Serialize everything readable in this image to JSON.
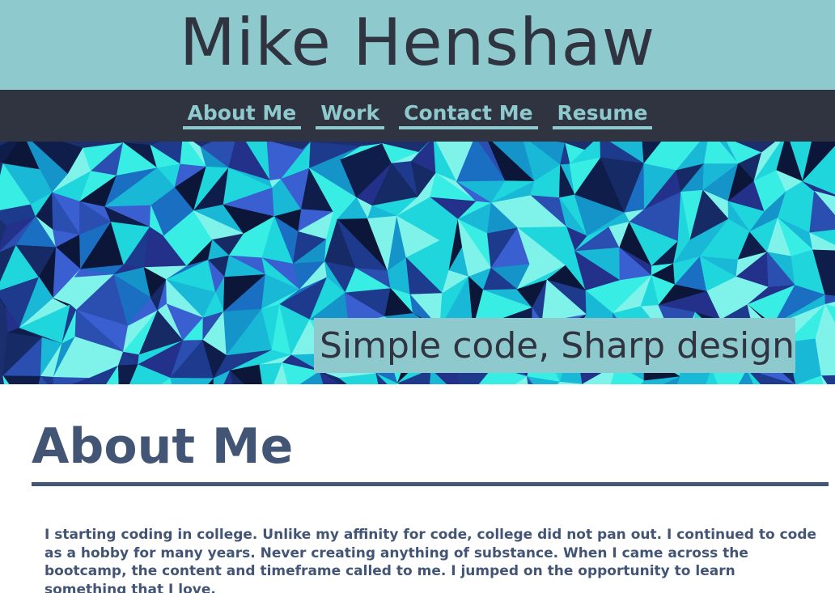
{
  "site": {
    "title": "Mike Henshaw"
  },
  "nav": {
    "items": [
      {
        "label": "About Me"
      },
      {
        "label": "Work"
      },
      {
        "label": "Contact Me"
      },
      {
        "label": "Resume"
      }
    ]
  },
  "hero": {
    "tagline": "Simple code, Sharp design"
  },
  "about": {
    "heading": "About Me",
    "body": "I starting coding in college. Unlike my affinity for code, college did not pan out. I continued to code as a hobby for many years. Never creating anything of substance. When I came across the bootcamp, the content and timeframe called to me. I jumped on the opportunity to learn something that I love."
  },
  "colors": {
    "header_bg": "#8ec9cd",
    "nav_bg": "#2f3440",
    "accent_text": "#435575",
    "hero_dark": "#1b2f6e",
    "hero_light": "#1fe6e0"
  }
}
